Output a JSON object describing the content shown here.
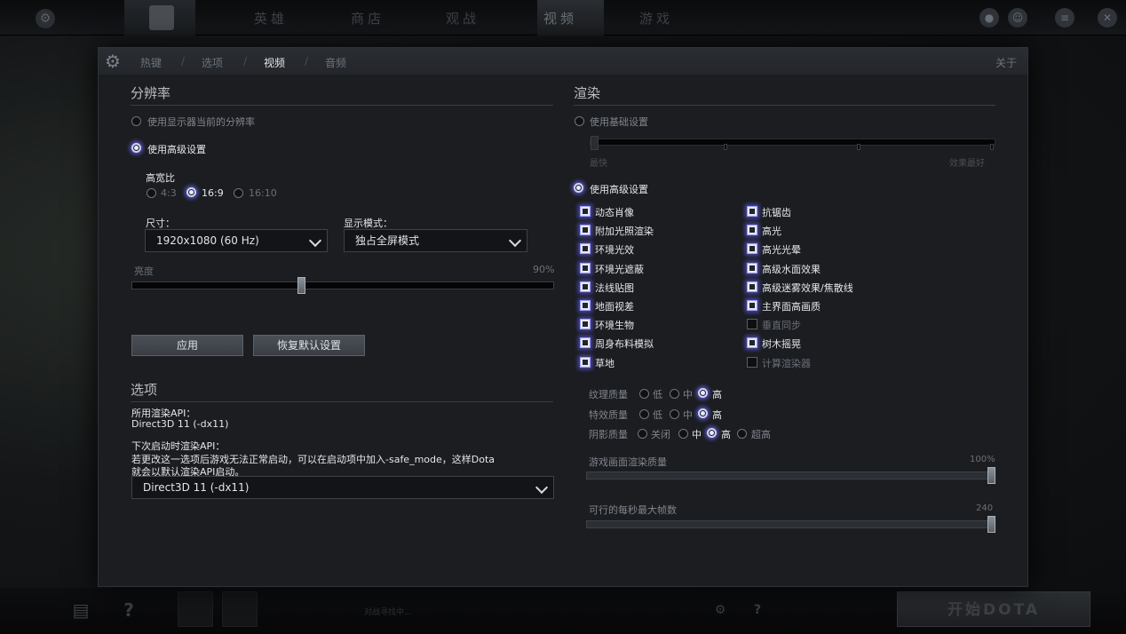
{
  "topbar": {
    "tabs": [
      "英雄",
      "商店",
      "观战",
      "视频",
      "游戏"
    ]
  },
  "bottombar": {
    "status_text": "对战寻找中...",
    "play_label": "开始DOTA"
  },
  "dialog": {
    "nav": {
      "hotkeys": "热键",
      "options": "选项",
      "video": "视频",
      "audio": "音频",
      "separator": "/",
      "about": "关于"
    },
    "resolution": {
      "title": "分辨率",
      "use_current": "使用显示器当前的分辨率",
      "use_advanced": "使用高级设置",
      "aspect_label": "高宽比",
      "aspect_options": [
        "4:3",
        "16:9",
        "16:10"
      ],
      "aspect_selected": "16:9",
      "size_label": "尺寸：",
      "size_value": "1920x1080 (60 Hz)",
      "display_mode_label": "显示模式：",
      "display_mode_value": "独占全屏模式",
      "brightness_label": "亮度",
      "brightness_value_text": "90%",
      "brightness_level": 0.42,
      "apply_button": "应用",
      "reset_button": "恢复默认设置"
    },
    "options": {
      "title": "选项",
      "api_label": "所用渲染API：",
      "api_value": "Direct3D 11 (-dx11)",
      "next_api_label": "下次启动时渲染API：",
      "next_api_note_1": "若更改这一选项后游戏无法正常启动，可以在启动项中加入-safe_mode，这样Dota",
      "next_api_note_2": "就会以默认渲染API启动。",
      "next_api_value": "Direct3D 11 (-dx11)"
    },
    "render": {
      "title": "渲染",
      "use_basic": "使用基础设置",
      "basic_left": "最快",
      "basic_right": "效果最好",
      "basic_level": 0,
      "use_advanced": "使用高级设置",
      "left_checks": [
        {
          "label": "动态肖像",
          "checked": true
        },
        {
          "label": "附加光照渲染",
          "checked": true
        },
        {
          "label": "环境光效",
          "checked": true
        },
        {
          "label": "环境光遮蔽",
          "checked": true
        },
        {
          "label": "法线贴图",
          "checked": true
        },
        {
          "label": "地面视差",
          "checked": true
        },
        {
          "label": "环境生物",
          "checked": true
        },
        {
          "label": "周身布料模拟",
          "checked": true
        },
        {
          "label": "草地",
          "checked": true
        }
      ],
      "right_checks": [
        {
          "label": "抗锯齿",
          "checked": true
        },
        {
          "label": "高光",
          "checked": true
        },
        {
          "label": "高光光晕",
          "checked": true
        },
        {
          "label": "高级水面效果",
          "checked": true
        },
        {
          "label": "高级迷雾效果/焦散线",
          "checked": true
        },
        {
          "label": "主界面高画质",
          "checked": true
        },
        {
          "label": "垂直同步",
          "checked": false
        },
        {
          "label": "树木摇晃",
          "checked": true
        },
        {
          "label": "计算渲染器",
          "checked": false
        }
      ],
      "texture_quality": {
        "label": "纹理质量",
        "options": [
          "低",
          "中",
          "高"
        ],
        "selected": "高"
      },
      "effects_quality": {
        "label": "特效质量",
        "options": [
          "低",
          "中",
          "高"
        ],
        "selected": "高"
      },
      "shadow_quality": {
        "label": "阴影质量",
        "options": [
          "关闭",
          "中",
          "高",
          "超高"
        ],
        "selected": "高"
      },
      "render_quality_label": "游戏画面渲染质量",
      "render_quality_value_text": "100%",
      "render_quality_level": 1.0,
      "max_fps_label": "可行的每秒最大帧数",
      "max_fps_value_text": "240",
      "max_fps_level": 1.0
    }
  }
}
